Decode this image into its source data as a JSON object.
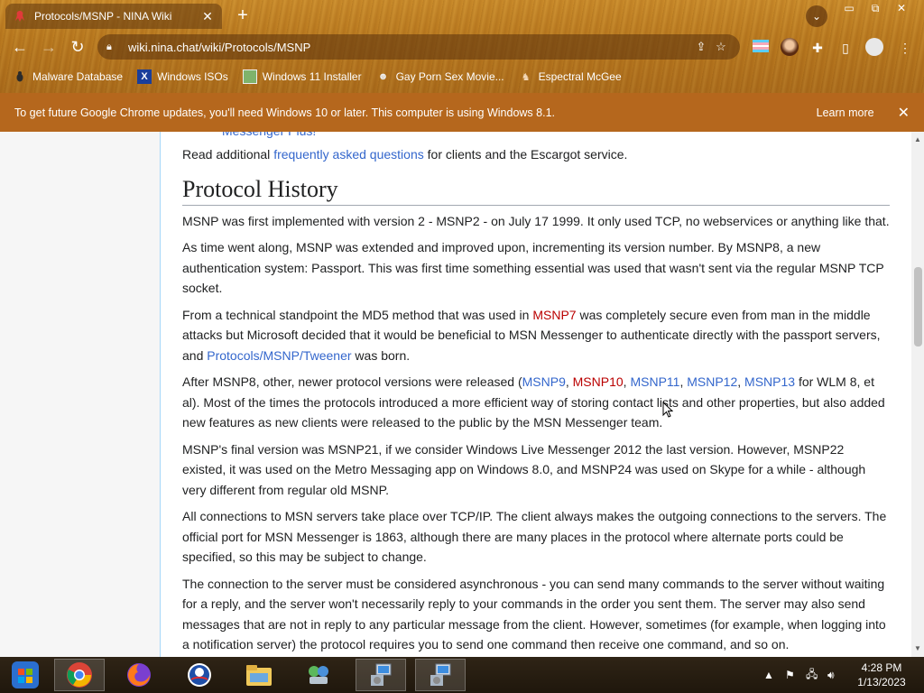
{
  "browser": {
    "tab_title": "Protocols/MSNP - NINA Wiki",
    "new_tab_label": "+",
    "url": "wiki.nina.chat/wiki/Protocols/MSNP",
    "bookmarks": [
      {
        "label": "Malware Database",
        "icon": "bug-icon"
      },
      {
        "label": "Windows ISOs",
        "icon": "x-logo-icon"
      },
      {
        "label": "Windows 11 Installer",
        "icon": "image-icon"
      },
      {
        "label": "Gay Porn Sex Movie...",
        "icon": "cat-icon"
      },
      {
        "label": "Espectral McGee",
        "icon": "character-icon"
      }
    ]
  },
  "infobar": {
    "message": "To get future Google Chrome updates, you'll need Windows 10 or later. This computer is using Windows 8.1.",
    "learn_more": "Learn more"
  },
  "article": {
    "cut_off_text": "Messenger Plus!",
    "faq_line": {
      "pre": "Read additional ",
      "link": "frequently asked questions",
      "post": " for clients and the Escargot service."
    },
    "heading": "Protocol History",
    "p1": "MSNP was first implemented with version 2 - MSNP2 - on July 17 1999. It only used TCP, no webservices or anything like that.",
    "p2": "As time went along, MSNP was extended and improved upon, incrementing its version number. By MSNP8, a new authentication system: Passport. This was first time something essential was used that wasn't sent via the regular MSNP TCP socket.",
    "p3": {
      "a": "From a technical standpoint the MD5 method that was used in ",
      "link1": "MSNP7",
      "b": " was completely secure even from man in the middle attacks but Microsoft decided that it would be beneficial to MSN Messenger to authenticate directly with the passport servers, and ",
      "link2": "Protocols/MSNP/Tweener",
      "c": " was born."
    },
    "p4": {
      "a": "After MSNP8, other, newer protocol versions were released (",
      "l1": "MSNP9",
      "s1": ", ",
      "l2": "MSNP10",
      "s2": ", ",
      "l3": "MSNP11",
      "s3": ", ",
      "l4": "MSNP12",
      "s4": ", ",
      "l5": "MSNP13",
      "b": " for WLM 8, et al). Most of the times the protocols introduced a more efficient way of storing contact lists and other properties, but also added new features as new clients were released to the public by the MSN Messenger team."
    },
    "p5": "MSNP's final version was MSNP21, if we consider Windows Live Messenger 2012 the last version. However, MSNP22 existed, it was used on the Metro Messaging app on Windows 8.0, and MSNP24 was used on Skype for a while - although very different from regular old MSNP.",
    "p6": "All connections to MSN servers take place over TCP/IP. The client always makes the outgoing connections to the servers. The official port for MSN Messenger is 1863, although there are many places in the protocol where alternate ports could be specified, so this may be subject to change.",
    "p7": "The connection to the server must be considered asynchronous - you can send many commands to the server without waiting for a reply, and the server won't necessarily reply to your commands in the order you sent them. The server may also send messages that are not in reply to any particular message from the client. However, sometimes (for example, when logging into a notification server) the protocol requires you to send one command then receive one command, and so on."
  },
  "taskbar": {
    "items": [
      "start-button",
      "chrome",
      "firefox",
      "obama-app",
      "file-explorer",
      "network-app",
      "installer-1",
      "installer-2"
    ],
    "time": "4:28 PM",
    "date": "1/13/2023"
  },
  "colors": {
    "link": "#3366cc",
    "redlink": "#ba0000",
    "infobar": "#b5671d",
    "theme": "#b9791f"
  }
}
